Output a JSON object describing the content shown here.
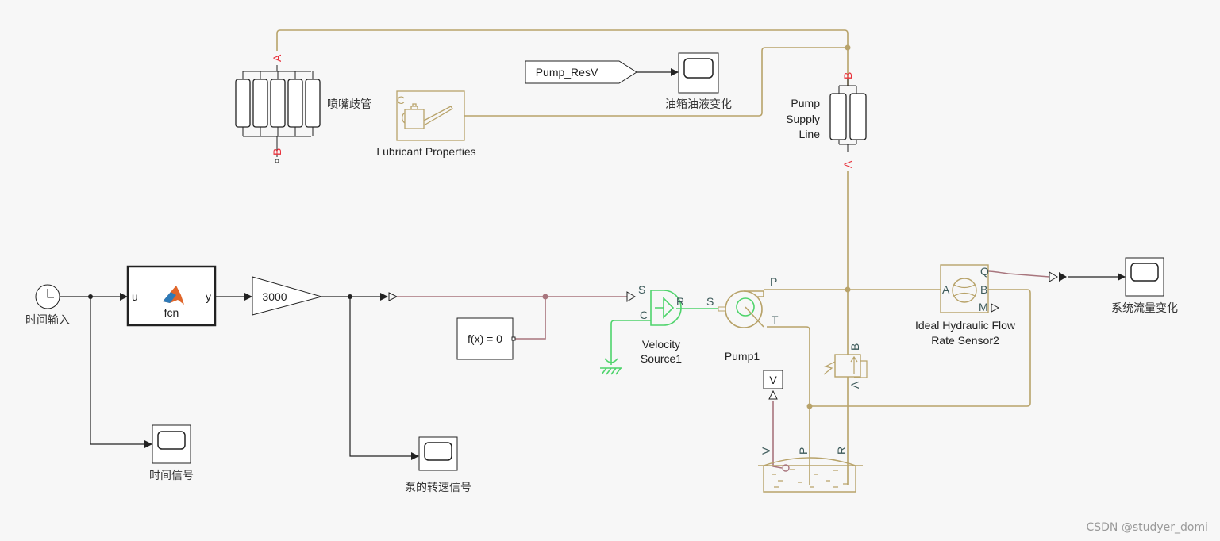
{
  "blocks": {
    "clock": {
      "label": "时间输入"
    },
    "fcn": {
      "name": "fcn",
      "in_port": "u",
      "out_port": "y"
    },
    "gain": {
      "value": "3000"
    },
    "scope_time": {
      "label": "时间信号"
    },
    "scope_speed": {
      "label": "泵的转速信号"
    },
    "constant": {
      "expr": "f(x) = 0"
    },
    "velocity_source": {
      "label_line1": "Velocity",
      "label_line2": "Source1",
      "port_s": "S",
      "port_r": "R",
      "port_c": "C"
    },
    "pump": {
      "label": "Pump1",
      "port_s": "S",
      "port_p": "P",
      "port_t": "T"
    },
    "nozzle_manifold": {
      "label": "喷嘴歧管",
      "port_a": "A",
      "port_b": "B"
    },
    "lubricant": {
      "label": "Lubricant Properties",
      "port_c": "C"
    },
    "goto_tag": {
      "tag": "Pump_ResV"
    },
    "scope_tank": {
      "label": "油箱油液变化"
    },
    "supply_line": {
      "label_line1": "Pump",
      "label_line2": "Supply",
      "label_line3": "Line",
      "port_a": "A",
      "port_b": "B"
    },
    "relief_valve": {
      "port_a": "A",
      "port_b": "B"
    },
    "reservoir": {
      "port_v": "V",
      "port_p": "P",
      "port_r": "R"
    },
    "v_from": {
      "tag": "V"
    },
    "flow_sensor": {
      "label_line1": "Ideal Hydraulic Flow",
      "label_line2": "Rate Sensor2",
      "port_a": "A",
      "port_b": "B",
      "port_q": "Q",
      "port_m": "M"
    },
    "scope_flow": {
      "label": "系统流量变化"
    }
  },
  "watermark": "CSDN @studyer_domi",
  "colors": {
    "background": "#f7f7f7",
    "hydraulic": "#b8a36a",
    "physical_signal": "#a8757d",
    "mechanical": "#4fd46c",
    "port_label_red": "#e8323c"
  }
}
